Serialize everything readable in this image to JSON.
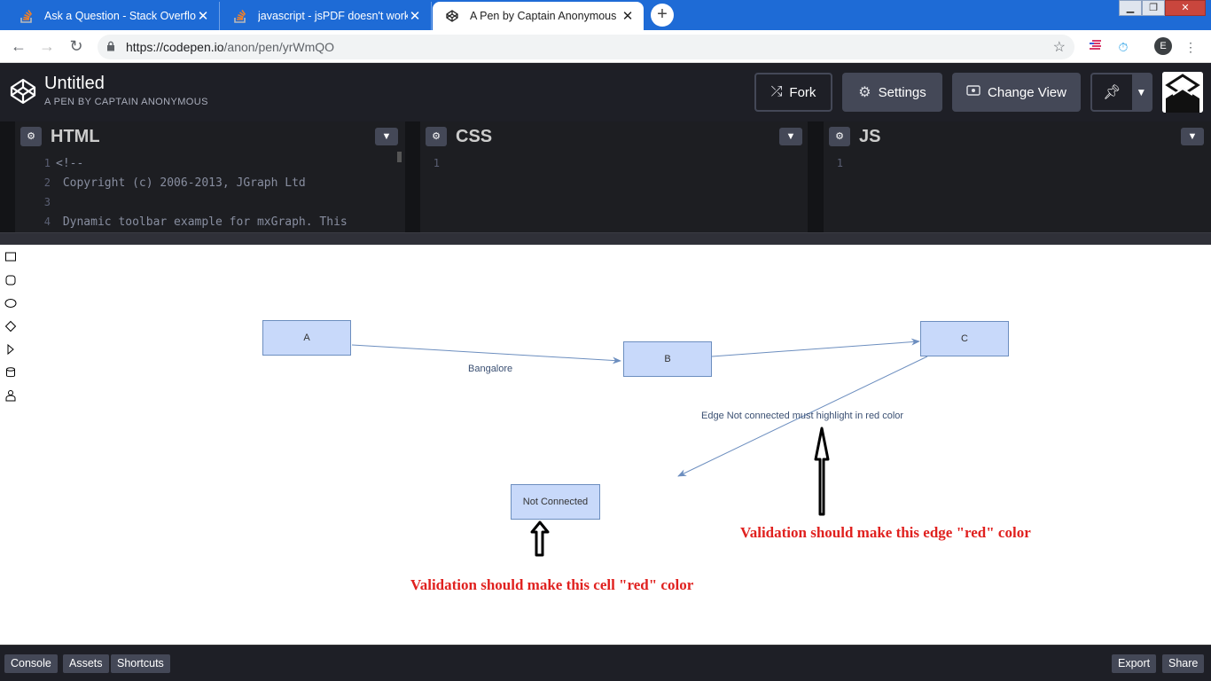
{
  "browser": {
    "tabs": [
      {
        "title": "Ask a Question - Stack Overflow",
        "icon": "stackoverflow-icon",
        "active": false
      },
      {
        "title": "javascript - jsPDF doesn't work in",
        "icon": "stackoverflow-icon",
        "active": false
      },
      {
        "title": "A Pen by Captain Anonymous",
        "icon": "codepen-icon",
        "active": true
      }
    ],
    "new_tab": "+",
    "address": {
      "host": "https://codepen.io",
      "path": "/anon/pen/yrWmQO"
    },
    "profile_initial": "E",
    "colors": {
      "tabstrip": "#1e6bd6"
    }
  },
  "codepen": {
    "title": "Untitled",
    "subtitle": "A PEN BY CAPTAIN ANONYMOUS",
    "buttons": {
      "fork": "Fork",
      "settings": "Settings",
      "change_view": "Change View"
    },
    "editors": [
      {
        "name": "HTML",
        "lines": [
          {
            "num": "1",
            "text": "<!--"
          },
          {
            "num": "2",
            "text": "  Copyright (c) 2006-2013, JGraph Ltd"
          },
          {
            "num": "3",
            "text": ""
          },
          {
            "num": "4",
            "text": "  Dynamic toolbar example for mxGraph. This"
          }
        ]
      },
      {
        "name": "CSS",
        "lines": [
          {
            "num": "1",
            "text": ""
          }
        ]
      },
      {
        "name": "JS",
        "lines": [
          {
            "num": "1",
            "text": ""
          }
        ]
      }
    ]
  },
  "result": {
    "toolbar_icons": [
      "rectangle-icon",
      "rounded-rectangle-icon",
      "ellipse-icon",
      "rhombus-icon",
      "triangle-icon",
      "cylinder-icon",
      "actor-icon"
    ],
    "nodes": {
      "a": "A",
      "b": "B",
      "c": "C",
      "not_connected": "Not Connected"
    },
    "edge_labels": {
      "ab": "Bangalore",
      "dangling": "Edge Not connected must highlight in red color"
    },
    "notes": {
      "edge": "Validation should make this edge \"red\" color",
      "cell": "Validation should make this cell \"red\" color"
    },
    "colors": {
      "node_fill": "#c8d9fa",
      "node_stroke": "#6c8ebf",
      "note": "#e0211f"
    }
  },
  "bottom_bar": {
    "console": "Console",
    "assets": "Assets",
    "shortcuts": "Shortcuts",
    "export": "Export",
    "share": "Share"
  }
}
